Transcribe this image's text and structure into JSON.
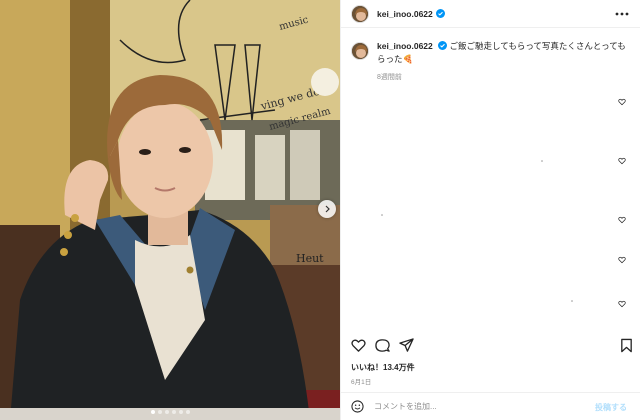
{
  "post": {
    "username": "kei_inoo.0622",
    "verified": true,
    "caption": "ご飯ご馳走してもらって写真たくさんとってもらった🍕",
    "caption_time": "8週間前",
    "likes": "いいね！13.4万件",
    "date": "6月1日",
    "carousel": {
      "count": 6,
      "active_index": 0
    },
    "comment_placeholder": "コメントを追加...",
    "post_button": "投稿する"
  },
  "icons": {
    "more": "more-horizontal-icon",
    "verified": "verified-badge-icon",
    "like": "heart-icon",
    "comment": "comment-icon",
    "share": "send-icon",
    "save": "bookmark-icon",
    "emoji": "emoji-icon",
    "carousel_next": "chevron-right-icon"
  },
  "colors": {
    "verified_blue": "#0095f6",
    "post_button_disabled": "#b2dffc",
    "muted_text": "#8e8e8e"
  }
}
